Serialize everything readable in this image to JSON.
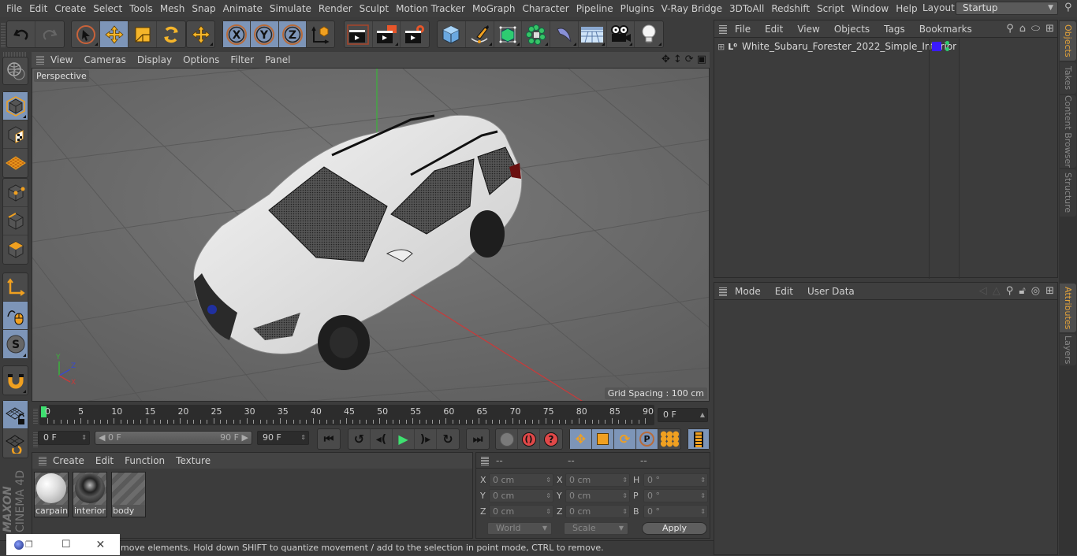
{
  "menubar": {
    "items": [
      "File",
      "Edit",
      "Create",
      "Select",
      "Tools",
      "Mesh",
      "Snap",
      "Animate",
      "Simulate",
      "Render",
      "Sculpt",
      "Motion Tracker",
      "MoGraph",
      "Character",
      "Pipeline",
      "Plugins",
      "V-Ray Bridge",
      "3DToAll",
      "Redshift",
      "Script",
      "Window",
      "Help"
    ],
    "layout_label": "Layout:",
    "layout_value": "Startup"
  },
  "toolbar": {
    "history": [
      "undo-icon",
      "redo-icon"
    ],
    "tools": [
      "live-selection-icon",
      "move-icon",
      "scale-icon",
      "rotate-icon"
    ],
    "recent_tool": "move-icon",
    "axes": [
      "X",
      "Y",
      "Z"
    ],
    "coord_system": "world-coordinates-icon",
    "render": [
      "render-view-icon",
      "render-picture-viewer-icon",
      "edit-render-settings-icon"
    ],
    "create": [
      "cube-icon",
      "pen-icon",
      "subdivision-surface-icon",
      "cloner-icon",
      "deformer-icon",
      "floor-icon",
      "camera-icon",
      "light-icon"
    ]
  },
  "left_tools": {
    "modes": [
      "make-editable-icon",
      "model-mode-icon",
      "texture-mode-icon",
      "workplane-mode-icon",
      "points-mode-icon",
      "edges-mode-icon",
      "polygons-mode-icon",
      "axis-mode-icon",
      "tweak-mode-icon",
      "solo-icon",
      "snap-icon",
      "lock-workplane-icon",
      "workplane-align-icon"
    ]
  },
  "viewport": {
    "menu": [
      "View",
      "Cameras",
      "Display",
      "Options",
      "Filter",
      "Panel"
    ],
    "camera_label": "Perspective",
    "grid_spacing": "Grid Spacing : 100 cm",
    "axis_labels": {
      "x": "X",
      "y": "Y",
      "z": "Z"
    },
    "nav_icons": [
      "pan-icon",
      "dolly-icon",
      "orbit-icon",
      "maximize-view-icon"
    ],
    "colors": {
      "x_axis": "#c83a3a",
      "y_axis": "#3ab33a",
      "z_axis": "#3a4acc",
      "bg": "#6e6e6e"
    }
  },
  "timeline": {
    "ticks": [
      "0",
      "5",
      "10",
      "15",
      "20",
      "25",
      "30",
      "35",
      "40",
      "45",
      "50",
      "55",
      "60",
      "65",
      "70",
      "75",
      "80",
      "85",
      "90"
    ],
    "current_frame": "0 F",
    "start_frame": "0 F",
    "range_start": "0 F",
    "range_end": "90 F",
    "end_frame": "90 F"
  },
  "transport": {
    "playback": [
      "go-to-start-icon",
      "previous-key-icon",
      "previous-frame-icon",
      "play-icon",
      "next-frame-icon",
      "next-key-icon",
      "go-to-end-icon"
    ],
    "keys": [
      "record-active-icon",
      "autokey-icon",
      "keyframe-selection-icon"
    ],
    "key_tracks": [
      "position-key-icon",
      "scale-key-icon",
      "rotation-key-icon",
      "parameter-key-icon",
      "point-level-key-icon"
    ],
    "timeline_icon": "timeline-window-icon"
  },
  "materials": {
    "menu": [
      "Create",
      "Edit",
      "Function",
      "Texture"
    ],
    "items": [
      {
        "name": "carpaint",
        "preview": "white-glossy"
      },
      {
        "name": "interior",
        "preview": "dark-textured"
      },
      {
        "name": "body",
        "preview": "empty"
      }
    ]
  },
  "coordinates": {
    "headers": [
      "--",
      "--",
      "--"
    ],
    "rows": [
      {
        "pos_axis": "X",
        "pos": "0 cm",
        "size_axis": "X",
        "size": "0 cm",
        "rot_axis": "H",
        "rot": "0 °"
      },
      {
        "pos_axis": "Y",
        "pos": "0 cm",
        "size_axis": "Y",
        "size": "0 cm",
        "rot_axis": "P",
        "rot": "0 °"
      },
      {
        "pos_axis": "Z",
        "pos": "0 cm",
        "size_axis": "Z",
        "size": "0 cm",
        "rot_axis": "B",
        "rot": "0 °"
      }
    ],
    "space_dropdown": "World",
    "mode_dropdown": "Scale",
    "apply_label": "Apply"
  },
  "status": {
    "text": "move elements. Hold down SHIFT to quantize movement / add to the selection in point mode, CTRL to remove."
  },
  "branding": {
    "maxon": "MAXON",
    "product": "CINEMA 4D"
  },
  "objects_panel": {
    "menu": [
      "File",
      "Edit",
      "View",
      "Objects",
      "Tags",
      "Bookmarks"
    ],
    "objects": [
      {
        "name": "White_Subaru_Forester_2022_Simple_Interior",
        "layer_color": "#3a1aff",
        "visible_editor": "#2ecc71",
        "visible_render": "#2ecc71"
      }
    ]
  },
  "attributes_panel": {
    "menu": [
      "Mode",
      "Edit",
      "User Data"
    ]
  },
  "right_tabs": {
    "top": [
      {
        "label": "Objects",
        "active": true
      },
      {
        "label": "Takes",
        "active": false
      },
      {
        "label": "Content Browser",
        "active": false
      },
      {
        "label": "Structure",
        "active": false
      }
    ],
    "bottom": [
      {
        "label": "Attributes",
        "active": true
      },
      {
        "label": "Layers",
        "active": false
      }
    ]
  },
  "accent_colors": {
    "tool_active": "#7d95b8",
    "tab_active": "#e3a33a",
    "icon_orange": "#f0a020"
  }
}
